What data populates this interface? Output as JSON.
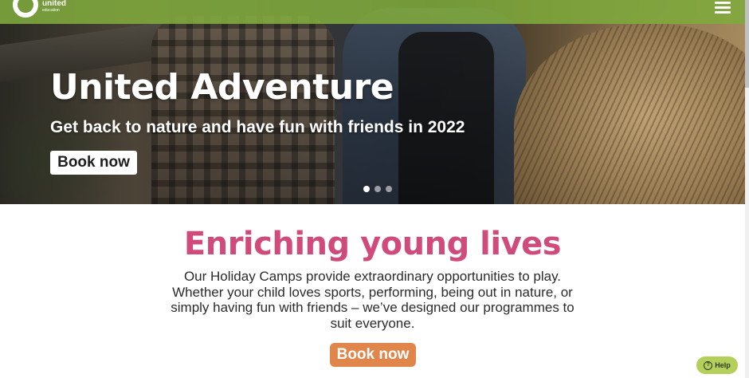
{
  "header": {
    "logo_line1": "united",
    "logo_line2": "education",
    "menu_icon": "hamburger-menu-icon",
    "bar_color": "#80aa3c"
  },
  "hero": {
    "title": "United Adventure",
    "subtitle": "Get back to nature and have fun with friends in 2022",
    "button_label": "Book now",
    "slides": {
      "total": 3,
      "active": 1
    }
  },
  "intro": {
    "title": "Enriching young lives",
    "title_color": "#d14a7c",
    "body": "Our Holiday Camps provide extraordinary opportunities to play. Whether your child loves sports, performing, being out in nature, or simply having fun with friends – we’ve designed our programmes to suit everyone.",
    "button_label": "Book now",
    "button_color": "#e0864b"
  },
  "help": {
    "label": "Help",
    "icon": "question-circle-icon",
    "icon_glyph": "?"
  }
}
